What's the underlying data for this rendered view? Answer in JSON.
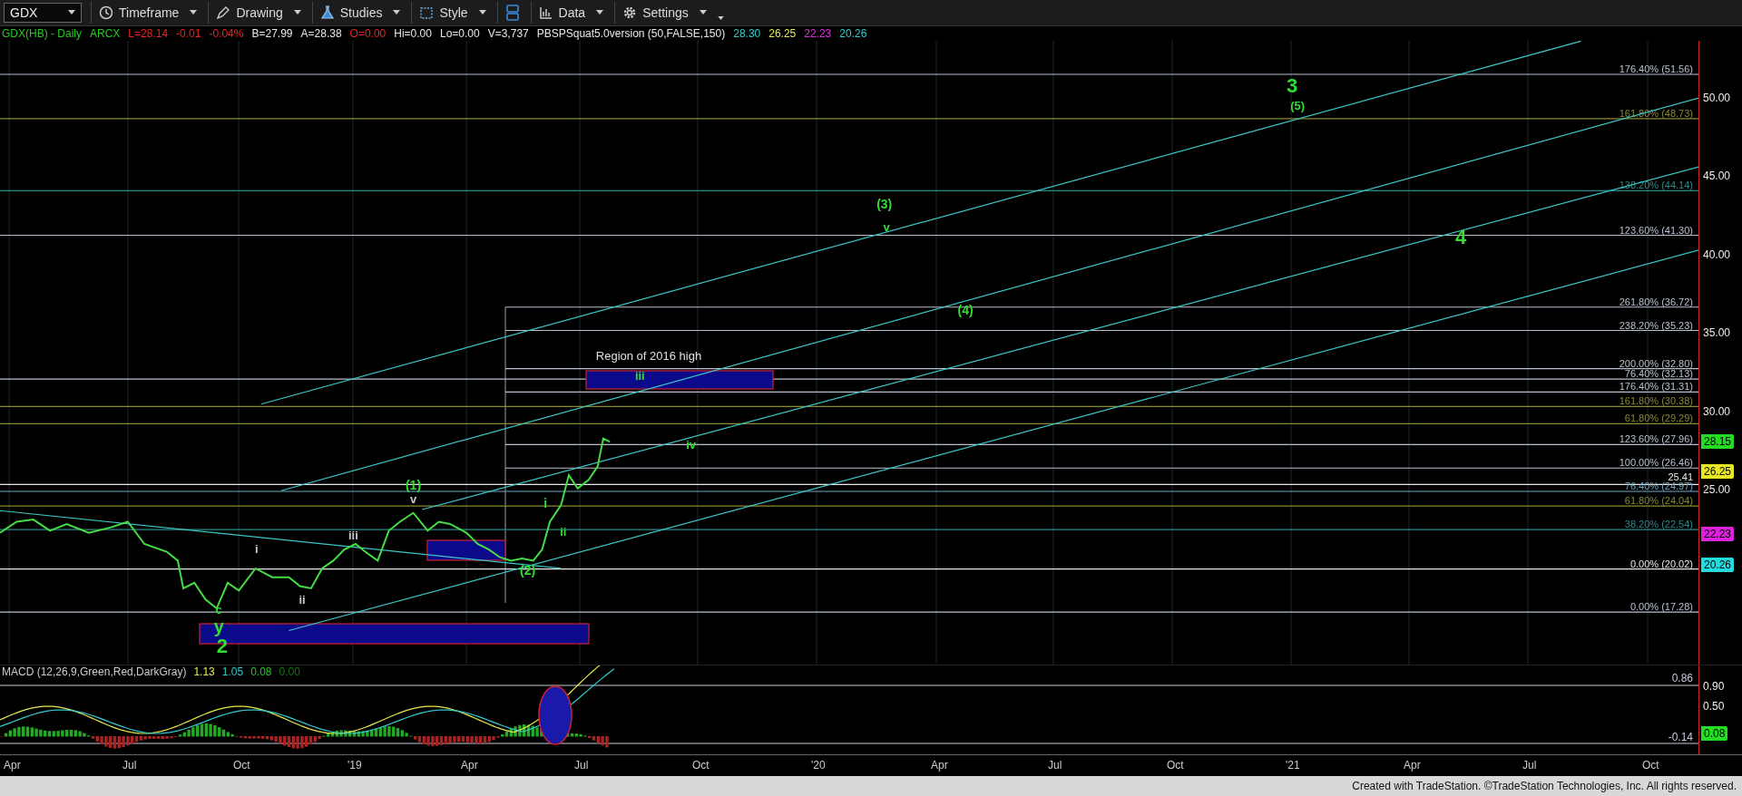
{
  "toolbar": {
    "symbol": "GDX",
    "buttons": [
      {
        "label": "Timeframe",
        "kind": "clock"
      },
      {
        "label": "Drawing",
        "kind": "pen"
      },
      {
        "label": "Studies",
        "kind": "flask"
      },
      {
        "label": "Style",
        "kind": "style"
      },
      {
        "kind": "layout"
      },
      {
        "label": "Data",
        "kind": "data"
      },
      {
        "label": "Settings",
        "kind": "gear"
      }
    ]
  },
  "info_line": [
    {
      "text": "GDX(HB) - Daily",
      "color": "#22cc22"
    },
    {
      "text": "ARCX",
      "color": "#22cc22"
    },
    {
      "text": "L=28.14",
      "color": "#ee2222"
    },
    {
      "text": "-0.01",
      "color": "#ee2222"
    },
    {
      "text": "-0.04%",
      "color": "#ee2222"
    },
    {
      "text": "B=27.99",
      "color": "#e8e8e8"
    },
    {
      "text": "A=28.38",
      "color": "#e8e8e8"
    },
    {
      "text": "O=0.00",
      "color": "#ee2222"
    },
    {
      "text": "Hi=0.00",
      "color": "#e8e8e8"
    },
    {
      "text": "Lo=0.00",
      "color": "#e8e8e8"
    },
    {
      "text": "V=3,737",
      "color": "#e8e8e8"
    },
    {
      "text": "PBSPSquat5.0version (50,FALSE,150)",
      "color": "#e8e8e8"
    },
    {
      "text": "28.30",
      "color": "#33cccc"
    },
    {
      "text": "26.25",
      "color": "#e8e84a"
    },
    {
      "text": "22.23",
      "color": "#dd33dd"
    },
    {
      "text": "20.26",
      "color": "#33cccc"
    }
  ],
  "chart": {
    "annotation": "Region of 2016 high",
    "wave_labels": [
      {
        "text": "3",
        "color": "#33dd33"
      },
      {
        "text": "(5)",
        "color": "#33dd33"
      },
      {
        "text": "(3)",
        "color": "#33dd33"
      },
      {
        "text": "v",
        "color": "#33dd33"
      },
      {
        "text": "4",
        "color": "#33dd33"
      },
      {
        "text": "(4)",
        "color": "#33dd33"
      },
      {
        "text": "iii",
        "color": "#33dd33"
      },
      {
        "text": "iv",
        "color": "#33dd33"
      },
      {
        "text": "(1)",
        "color": "#33dd33"
      },
      {
        "text": "v",
        "color": "#c8c8c8"
      },
      {
        "text": "iii",
        "color": "#c8c8c8"
      },
      {
        "text": "i",
        "color": "#c8c8c8"
      },
      {
        "text": "ii",
        "color": "#c8c8c8"
      },
      {
        "text": "c",
        "color": "#33dd33"
      },
      {
        "text": "y",
        "color": "#33dd33"
      },
      {
        "text": "2",
        "color": "#33dd33"
      },
      {
        "text": "(2)",
        "color": "#33dd33"
      },
      {
        "text": "i",
        "color": "#33dd33"
      },
      {
        "text": "ii",
        "color": "#33dd33"
      }
    ],
    "fib_levels": [
      {
        "label": "176.40% (51.56)",
        "color": "#b8c0d0"
      },
      {
        "label": "161.80% (48.73)",
        "color": "#8a8a30"
      },
      {
        "label": "138.20% (44.14)",
        "color": "#2a8a8a"
      },
      {
        "label": "123.60% (41.30)",
        "color": "#b8c0d0"
      },
      {
        "label": "261.80% (36.72)",
        "color": "#b8c0d0"
      },
      {
        "label": "238.20% (35.23)",
        "color": "#b8c0d0"
      },
      {
        "label": "200.00% (32.80)",
        "color": "#b8c0d0"
      },
      {
        "label": "76.40% (32.13)",
        "color": "#b8c0d0"
      },
      {
        "label": "176.40% (31.31)",
        "color": "#b8c0d0"
      },
      {
        "label": "161.80% (30.38)",
        "color": "#8a8a30"
      },
      {
        "label": "61.80% (29.29)",
        "color": "#8a8a30"
      },
      {
        "label": "123.60% (27.96)",
        "color": "#b8c0d0"
      },
      {
        "label": "100.00% (26.46)",
        "color": "#b8c0d0"
      },
      {
        "label": "25.41",
        "color": "#e8e8e8"
      },
      {
        "label": "76.40% (24.97)",
        "color": "#6aa8c8"
      },
      {
        "label": "61.80% (24.04)",
        "color": "#8a8a30"
      },
      {
        "label": "38.20% (22.54)",
        "color": "#2a8a8a"
      },
      {
        "label": "0.00% (20.02)",
        "color": "#e8e8e8"
      },
      {
        "label": "0.00% (17.28)",
        "color": "#b8c0d0"
      }
    ],
    "price_axis": [
      "50.00",
      "45.00",
      "40.00",
      "35.00",
      "30.00",
      "25.00"
    ],
    "price_tags": [
      {
        "text": "28.15",
        "color": "#22dd22"
      },
      {
        "text": "26.25",
        "color": "#e8e820"
      },
      {
        "text": "22.23",
        "color": "#dd22dd"
      },
      {
        "text": "20.26",
        "color": "#22dddd"
      }
    ]
  },
  "macd": {
    "title": "MACD (12,26,9,Green,Red,DarkGray)",
    "values": [
      {
        "text": "1.13",
        "color": "#e8e84a"
      },
      {
        "text": "1.05",
        "color": "#33cccc"
      },
      {
        "text": "0.08",
        "color": "#22cc22"
      },
      {
        "text": "0.00",
        "color": "#117711"
      }
    ],
    "line_label": "0.86",
    "low_label": "-0.14",
    "axis": [
      "0.90",
      "0.50"
    ],
    "tag": {
      "text": "0.08",
      "color": "#22dd22"
    }
  },
  "x_axis": [
    "Apr",
    "Jul",
    "Oct",
    "'19",
    "Apr",
    "Jul",
    "Oct",
    "'20",
    "Apr",
    "Jul",
    "Oct",
    "'21",
    "Apr",
    "Jul",
    "Oct"
  ],
  "footer": "Created with TradeStation. ©TradeStation Technologies, Inc. All rights reserved."
}
